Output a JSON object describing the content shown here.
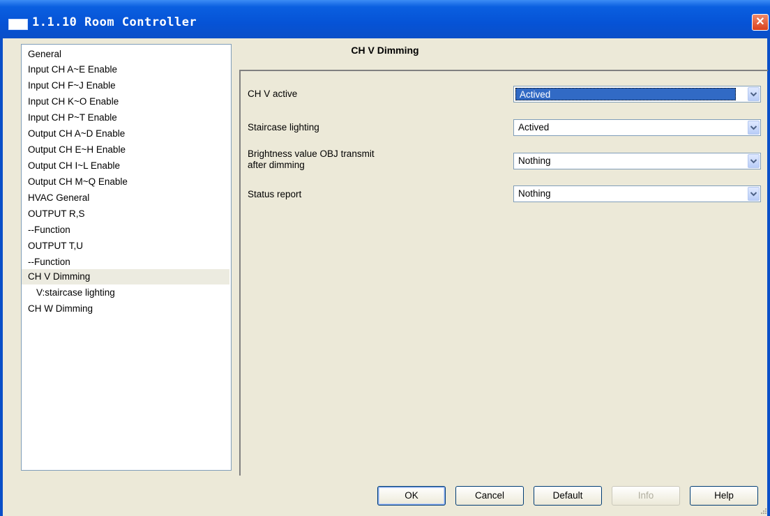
{
  "window": {
    "title": "1.1.10 Room Controller"
  },
  "tree": {
    "items": [
      {
        "label": "General"
      },
      {
        "label": "Input CH A~E Enable"
      },
      {
        "label": "Input CH F~J Enable"
      },
      {
        "label": "Input CH K~O Enable"
      },
      {
        "label": "Input CH P~T Enable"
      },
      {
        "label": "Output CH A~D Enable"
      },
      {
        "label": "Output CH E~H Enable"
      },
      {
        "label": "Output CH I~L Enable"
      },
      {
        "label": "Output CH M~Q Enable"
      },
      {
        "label": "HVAC General"
      },
      {
        "label": "OUTPUT R,S"
      },
      {
        "label": "--Function"
      },
      {
        "label": "OUTPUT T,U"
      },
      {
        "label": "--Function"
      },
      {
        "label": "CH V Dimming"
      },
      {
        "label": "V:staircase lighting"
      },
      {
        "label": "CH W Dimming"
      }
    ],
    "selected_index": 14
  },
  "main": {
    "title": "CH V Dimming",
    "params": [
      {
        "label": "CH V active",
        "value": "Actived"
      },
      {
        "label": "Staircase lighting",
        "value": "Actived"
      },
      {
        "label": "Brightness value OBJ transmit\nafter dimming",
        "value": "Nothing"
      },
      {
        "label": "Status report",
        "value": "Nothing"
      }
    ]
  },
  "buttons": {
    "ok": "OK",
    "cancel": "Cancel",
    "default": "Default",
    "info": "Info",
    "help": "Help"
  },
  "icons": {
    "window": "window-icon",
    "close": "close-icon",
    "dropdown": "chevron-down-icon",
    "resize": "resize-grip-icon"
  }
}
